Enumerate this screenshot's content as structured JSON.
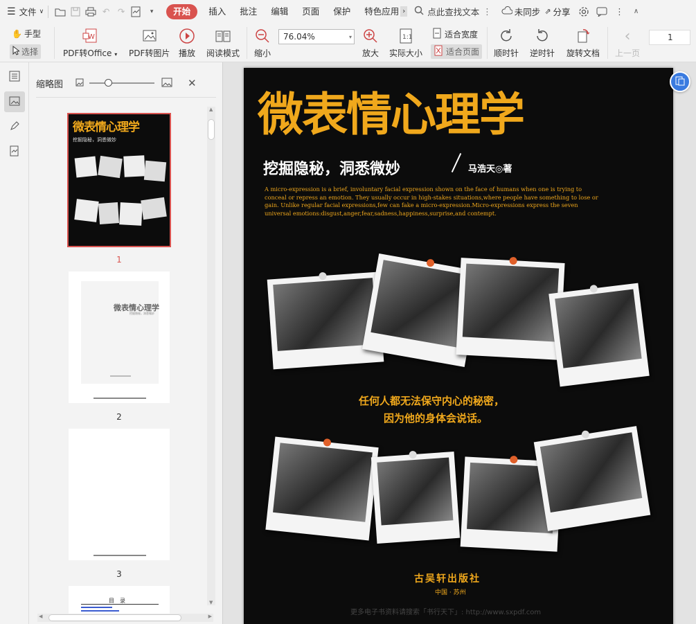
{
  "topbar": {
    "menu_label": "文件",
    "tabs": [
      "开始",
      "插入",
      "批注",
      "编辑",
      "页面",
      "保护",
      "特色应用"
    ],
    "search_placeholder": "点此查找文本",
    "sync_label": "未同步",
    "share_label": "分享"
  },
  "ribbon": {
    "hand_label": "手型",
    "select_label": "选择",
    "pdf_office": "PDF转Office",
    "pdf_image": "PDF转图片",
    "play": "播放",
    "read_mode": "阅读模式",
    "zoom_out": "缩小",
    "zoom_value": "76.04%",
    "zoom_in": "放大",
    "actual_size": "实际大小",
    "fit_width": "适合宽度",
    "fit_page": "适合页面",
    "rotate_cw": "顺时针",
    "rotate_ccw": "逆时针",
    "rotate_doc": "旋转文档",
    "prev_page": "上一页",
    "page_number": "1"
  },
  "thumbs": {
    "title": "缩略图",
    "pages": [
      {
        "num": "1",
        "title": "微表情心理学",
        "sub": "挖掘隐秘，洞悉微妙"
      },
      {
        "num": "2",
        "title": "微表情心理学",
        "sub": "挖掘隐秘，洞悉微妙"
      },
      {
        "num": "3"
      },
      {
        "num": "",
        "title": "目　录"
      }
    ]
  },
  "cover": {
    "title": "微表情心理学",
    "subtitle": "挖掘隐秘，洞悉微妙",
    "author": "马浩天◎著",
    "english": "A micro-expression is a brief, involuntary facial expression shown on the face of humans when one is trying to conceal or repress an emotion. They usually occur in high-stakes situations,where people have something to lose or gain. Unlike regular facial expressions,few can fake a micro-expression.Micro-expressions express the seven universal emotions:disgust,anger,fear,sadness,happiness,surprise,and contempt.",
    "quote1": "任何人都无法保守内心的秘密，",
    "quote2": "因为他的身体会说话。",
    "publisher": "古吴轩出版社",
    "place": "中国 · 苏州",
    "watermark": "更多电子书资料请搜索「书行天下」: http://www.sxpdf.com"
  },
  "colors": {
    "accent": "#d9534f",
    "cover_gold": "#f0a81c",
    "badge_blue": "#3a7be0"
  }
}
